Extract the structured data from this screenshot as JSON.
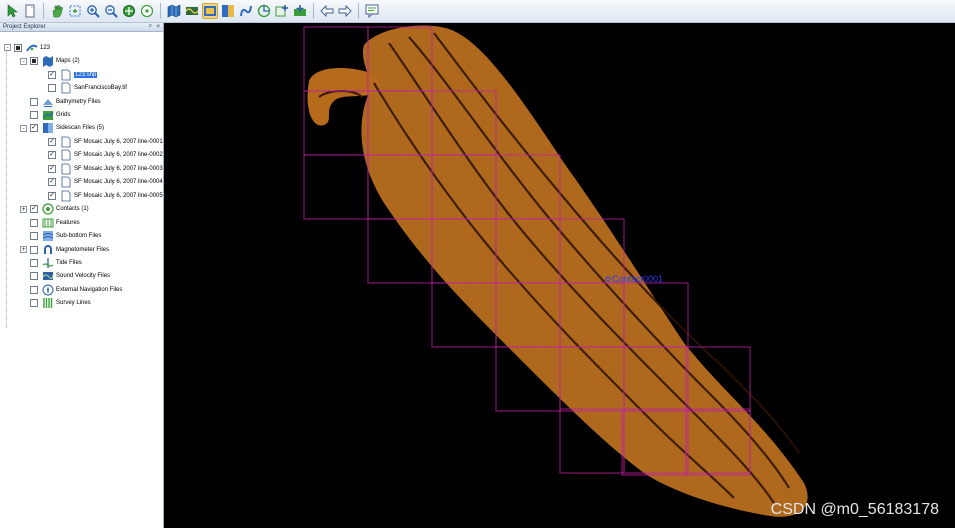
{
  "toolbar": {
    "buttons": [
      {
        "id": "pointer",
        "icon": "pointer-icon"
      },
      {
        "id": "new",
        "icon": "new-page-icon"
      },
      {
        "id": "pan",
        "icon": "pan-hand-icon"
      },
      {
        "id": "zoom-box",
        "icon": "zoom-box-icon"
      },
      {
        "id": "zoom-in",
        "icon": "zoom-in-icon"
      },
      {
        "id": "zoom-out",
        "icon": "zoom-out-icon"
      },
      {
        "id": "zoom-full",
        "icon": "zoom-full-icon"
      },
      {
        "id": "zoom-center",
        "icon": "zoom-center-icon"
      },
      {
        "id": "layers",
        "icon": "map-layer-icon"
      },
      {
        "id": "survey",
        "icon": "survey-icon"
      },
      {
        "id": "mosaic",
        "icon": "mosaic-icon",
        "active": true
      },
      {
        "id": "track",
        "icon": "track-icon"
      },
      {
        "id": "route",
        "icon": "route-icon"
      },
      {
        "id": "target",
        "icon": "target-icon"
      },
      {
        "id": "grid",
        "icon": "grid-plus-icon"
      },
      {
        "id": "add",
        "icon": "add-contact-icon"
      },
      {
        "id": "back",
        "icon": "arrow-left-icon"
      },
      {
        "id": "forward",
        "icon": "arrow-right-icon"
      },
      {
        "id": "comment",
        "icon": "comment-icon"
      }
    ]
  },
  "panel": {
    "title": "Project Explorer",
    "pin": "3",
    "close": "×"
  },
  "tree": [
    {
      "label": "123",
      "level": 0,
      "expander": "-",
      "checkbox": "partial",
      "icon": "project-icon"
    },
    {
      "label": "Maps (2)",
      "level": 1,
      "expander": "-",
      "checkbox": "partial",
      "icon": "maps-icon"
    },
    {
      "label": "123.shp",
      "level": 2,
      "expander": "",
      "checkbox": "checked",
      "icon": "file-icon",
      "selected": true
    },
    {
      "label": "SanFranciscoBay.tif",
      "level": 2,
      "expander": "",
      "checkbox": "unchecked",
      "icon": "file-icon"
    },
    {
      "label": "Bathymetry Files",
      "level": 1,
      "expander": "",
      "checkbox": "unchecked",
      "icon": "bathymetry-icon"
    },
    {
      "label": "Grids",
      "level": 1,
      "expander": "",
      "checkbox": "unchecked",
      "icon": "grids-icon"
    },
    {
      "label": "Sidescan Files (5)",
      "level": 1,
      "expander": "-",
      "checkbox": "checked",
      "icon": "sidescan-icon"
    },
    {
      "label": "SF Mosaic July 6, 2007 line-0001",
      "level": 2,
      "expander": "",
      "checkbox": "checked",
      "icon": "file-icon"
    },
    {
      "label": "SF Mosaic July 6, 2007 line-0002",
      "level": 2,
      "expander": "",
      "checkbox": "checked",
      "icon": "file-icon"
    },
    {
      "label": "SF Mosaic July 6, 2007 line-0003",
      "level": 2,
      "expander": "",
      "checkbox": "checked",
      "icon": "file-icon"
    },
    {
      "label": "SF Mosaic July 6, 2007 line-0004",
      "level": 2,
      "expander": "",
      "checkbox": "checked",
      "icon": "file-icon"
    },
    {
      "label": "SF Mosaic July 6, 2007 line-0005",
      "level": 2,
      "expander": "",
      "checkbox": "checked",
      "icon": "file-icon"
    },
    {
      "label": "Contacts (1)",
      "level": 1,
      "expander": "+",
      "checkbox": "checked",
      "icon": "contacts-icon"
    },
    {
      "label": "Features",
      "level": 1,
      "expander": "",
      "checkbox": "unchecked",
      "icon": "features-icon"
    },
    {
      "label": "Sub-bottom Files",
      "level": 1,
      "expander": "",
      "checkbox": "unchecked",
      "icon": "subbottom-icon"
    },
    {
      "label": "Magnetometer Files",
      "level": 1,
      "expander": "+",
      "checkbox": "unchecked",
      "icon": "magnetometer-icon"
    },
    {
      "label": "Tide Files",
      "level": 1,
      "expander": "",
      "checkbox": "unchecked",
      "icon": "tide-icon"
    },
    {
      "label": "Sound Velocity Files",
      "level": 1,
      "expander": "",
      "checkbox": "unchecked",
      "icon": "sound-velocity-icon"
    },
    {
      "label": "External Navigation Files",
      "level": 1,
      "expander": "",
      "checkbox": "unchecked",
      "icon": "navigation-icon"
    },
    {
      "label": "Survey Lines",
      "level": 1,
      "expander": "",
      "checkbox": "unchecked",
      "icon": "survey-lines-icon"
    }
  ],
  "map": {
    "contact_label": "Contact0001",
    "background": "#000000",
    "mosaic_color": "#b56a1c",
    "grid_color": "#c21fa6",
    "label_color": "#2b3cff"
  },
  "watermark": "CSDN @m0_56183178"
}
